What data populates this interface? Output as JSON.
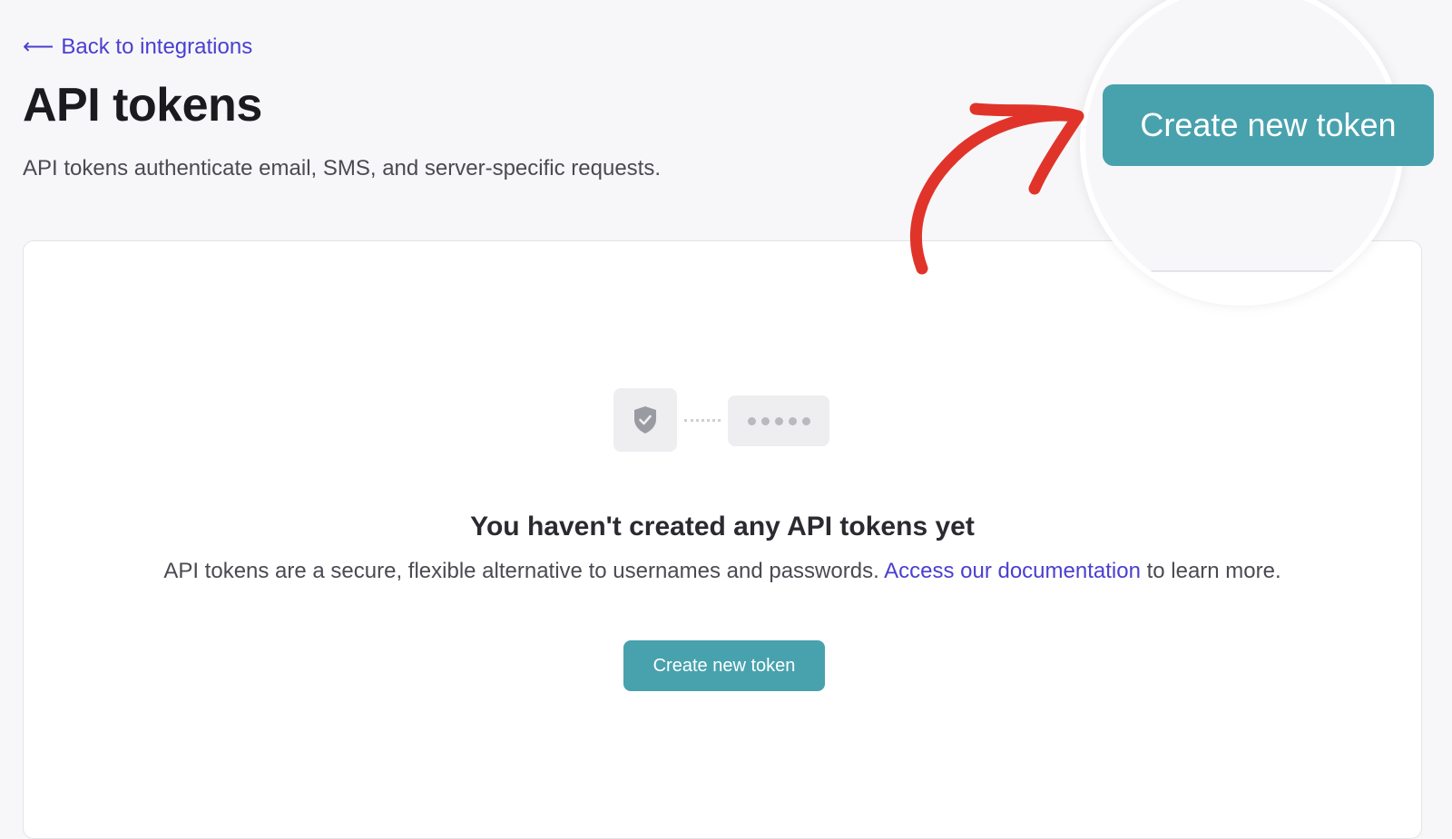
{
  "nav": {
    "back_arrow": "⟵",
    "back_label": "Back to integrations"
  },
  "header": {
    "title": "API tokens",
    "subtitle": "API tokens authenticate email, SMS, and server-specific requests.",
    "create_button_label": "Create new token"
  },
  "empty_state": {
    "title": "You haven't created any API tokens yet",
    "description_before": "API tokens are a secure, flexible alternative to usernames and passwords. ",
    "doc_link_label": "Access our documentation",
    "description_after": " to learn more.",
    "create_button_label": "Create new token",
    "icons": [
      "shield-check-icon",
      "password-dots-icon"
    ]
  },
  "colors": {
    "accent": "#48a2ae",
    "link": "#4a3fd1",
    "callout": "#e0342a",
    "background": "#f7f7f9"
  }
}
